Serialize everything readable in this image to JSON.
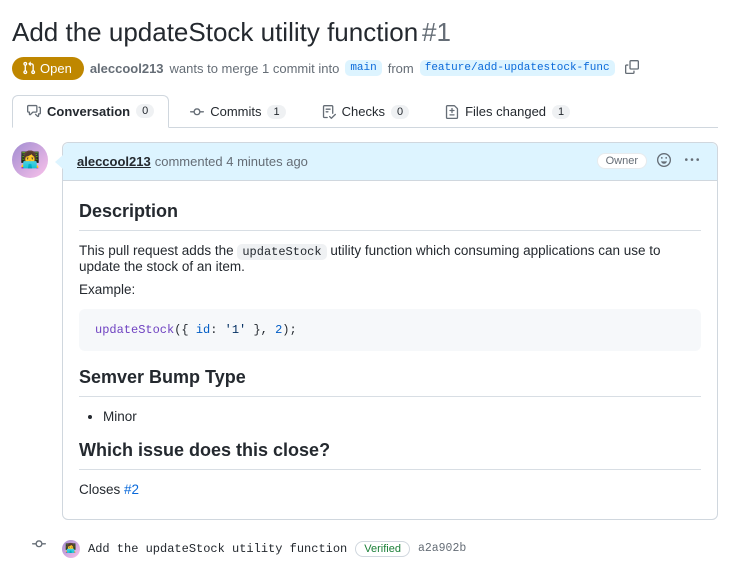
{
  "pr": {
    "title": "Add the updateStock utility function",
    "number": "#1",
    "state_label": "Open",
    "author": "aleccool213",
    "merge_text_1": "wants to merge 1 commit into",
    "base_branch": "main",
    "merge_text_2": "from",
    "head_branch": "feature/add-updatestock-func"
  },
  "tabs": {
    "conversation": {
      "label": "Conversation",
      "count": "0"
    },
    "commits": {
      "label": "Commits",
      "count": "1"
    },
    "checks": {
      "label": "Checks",
      "count": "0"
    },
    "files": {
      "label": "Files changed",
      "count": "1"
    }
  },
  "comment": {
    "author": "aleccool213",
    "time": "commented 4 minutes ago",
    "owner_label": "Owner",
    "h_description": "Description",
    "desc_p1_a": "This pull request adds the ",
    "desc_p1_code": "updateStock",
    "desc_p1_b": " utility function which consuming applications can use to update the stock of an item.",
    "example_label": "Example:",
    "code_fn": "updateStock",
    "code_key": "id",
    "code_str": "'1'",
    "code_num": "2",
    "h_semver": "Semver Bump Type",
    "semver_item": "Minor",
    "h_issue": "Which issue does this close?",
    "closes_text": "Closes ",
    "closes_link": "#2"
  },
  "commit": {
    "message": "Add the updateStock utility function",
    "verified": "Verified",
    "sha": "a2a902b"
  }
}
